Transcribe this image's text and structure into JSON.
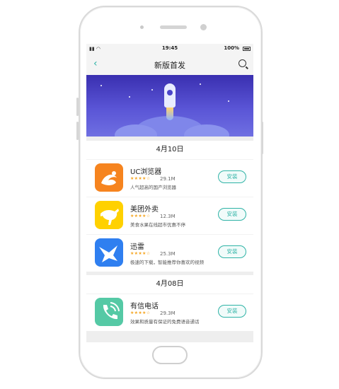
{
  "status": {
    "time": "19:45",
    "battery": "100%"
  },
  "nav": {
    "title": "新版首发"
  },
  "sections": [
    {
      "date": "4月10日",
      "apps": [
        {
          "name": "UC浏览器",
          "rating": "★★★★☆",
          "size": "29.1M",
          "desc": "人气超高的国产浏览器",
          "button": "安装",
          "color": "#f6841f",
          "icon": "squirrel-icon"
        },
        {
          "name": "美团外卖",
          "rating": "★★★★☆",
          "size": "12.3M",
          "desc": "美食水果在线超市优惠不停",
          "button": "安装",
          "color": "#ffd100",
          "icon": "kangaroo-icon"
        },
        {
          "name": "迅雷",
          "rating": "★★★★☆",
          "size": "25.3M",
          "desc": "极速的下载，智能推荐你喜欢的视频",
          "button": "安装",
          "color": "#2f7ff0",
          "icon": "bird-icon"
        }
      ]
    },
    {
      "date": "4月08日",
      "apps": [
        {
          "name": "有信电话",
          "rating": "★★★★☆",
          "size": "29.3M",
          "desc": "效果和质量有保证的免费语音通话",
          "button": "安装",
          "color": "#55c9a5",
          "icon": "phone-wifi-icon"
        }
      ]
    }
  ]
}
